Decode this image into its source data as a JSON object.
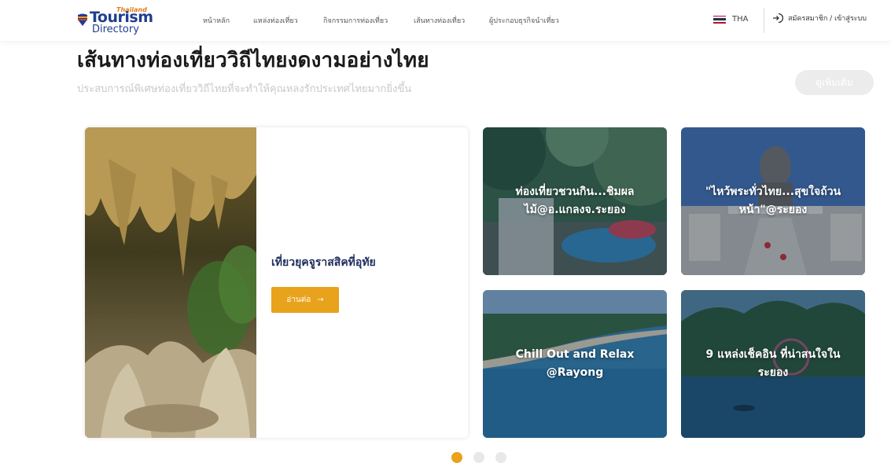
{
  "header": {
    "logo": {
      "tag": "Thailand",
      "word1": "Tourism",
      "word2": "Directory"
    },
    "nav": [
      "หน้าหลัก",
      "แหล่งท่องเที่ยว",
      "กิจกรรมการท่องเที่ยว",
      "เส้นทางท่องเที่ยว",
      "ผู้ประกอบธุรกิจนำเที่ยว"
    ],
    "lang": "THA",
    "login": "สมัครสมาชิก / เข้าสู่ระบบ"
  },
  "section": {
    "title": "เส้นทางท่องเที่ยววิถีไทยงดงามอย่างไทย",
    "subtitle": "ประสบการณ์พิเศษท่องเที่ยววิถีไทยที่จะทำให้คุณหลงรักประเทศไทยมากยิ่งขึ้น",
    "more_label": "ดูเพิ่มเติม"
  },
  "feature": {
    "title": "เที่ยวยุคจูราสสิคที่อุทัย",
    "read_label": "อ่านต่อ",
    "arrow": "→"
  },
  "cards": [
    {
      "title": "ท่องเที่ยวชวนกิน...ชิมผล\nไม้@อ.แกลงจ.ระยอง"
    },
    {
      "title": "\"ไหว้พระทั่วไทย...สุขใจถ้วน\nหน้า\"@ระยอง"
    },
    {
      "title": "Chill Out and Relax\n@Rayong"
    },
    {
      "title": "9 แหล่งเช็คอิน ที่น่าสนใจใน\nระยอง"
    }
  ],
  "pagination": {
    "count": 3,
    "active": 0
  },
  "colors": {
    "accent": "#e9a21b",
    "brand": "#1f3e8f",
    "title_text": "#1f2d5c"
  }
}
